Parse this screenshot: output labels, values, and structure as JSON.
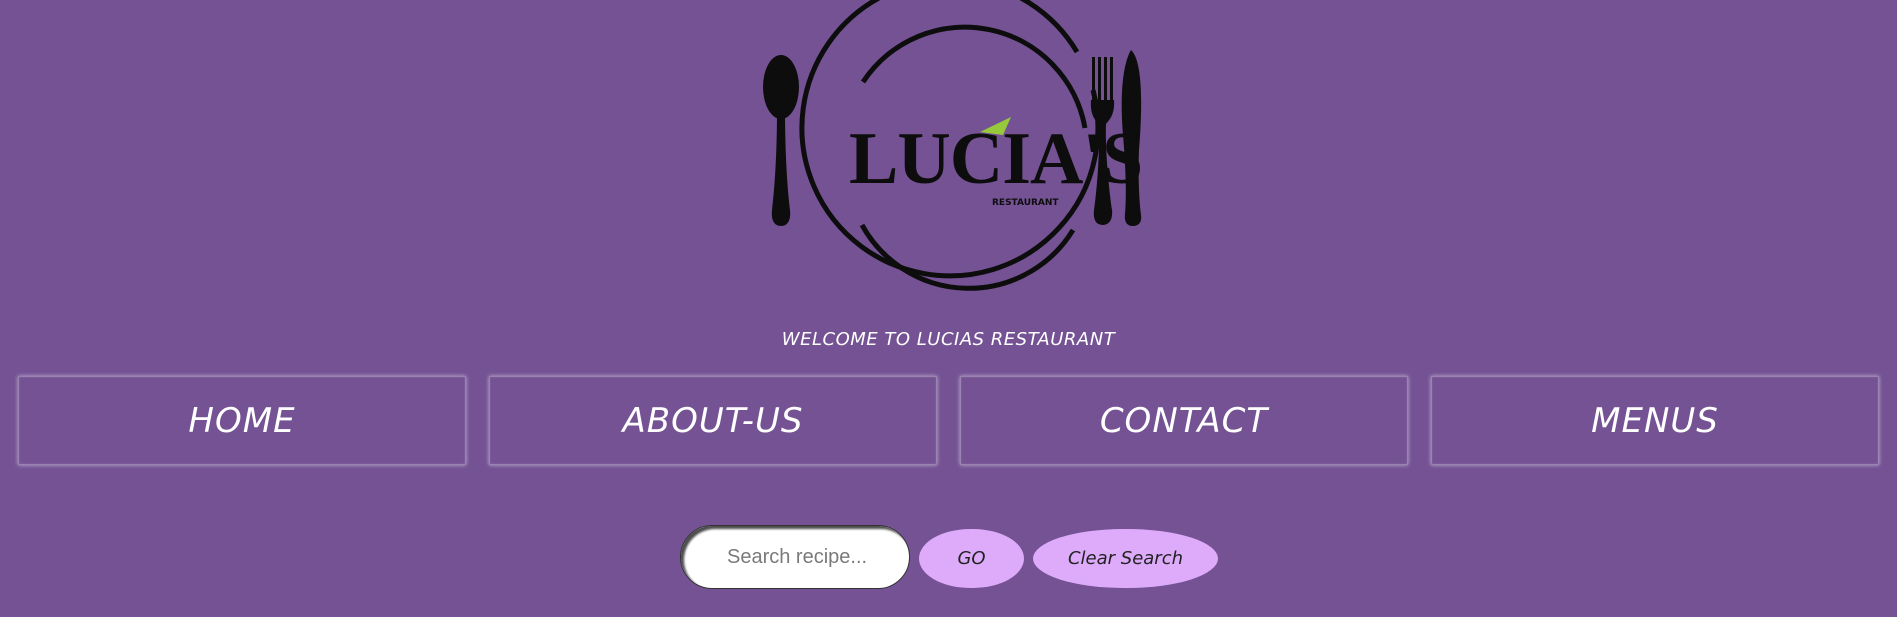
{
  "logo": {
    "name_text": "LUCIA'S",
    "sub_text": "RESTAURANT",
    "accent_color": "#97c93c",
    "ink_color": "#0d0d0d"
  },
  "header": {
    "welcome_text": "WELCOME TO LUCIAS RESTAURANT"
  },
  "nav": {
    "items": [
      {
        "label": "HOME"
      },
      {
        "label": "ABOUT-US"
      },
      {
        "label": "CONTACT"
      },
      {
        "label": "MENUS"
      }
    ]
  },
  "search": {
    "placeholder": "Search recipe...",
    "value": "",
    "go_label": "GO",
    "clear_label": "Clear Search"
  },
  "colors": {
    "background": "#745294",
    "button_fill": "#deabfb",
    "text_light": "#ffffff"
  }
}
